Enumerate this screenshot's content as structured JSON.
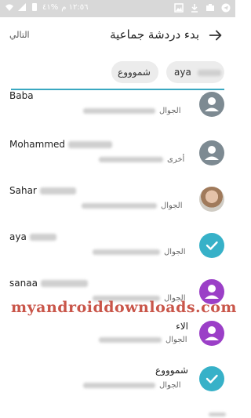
{
  "status_bar": {
    "time": "١٢:٥٦ م",
    "battery": "%٤١",
    "icons": [
      "signal-icon",
      "wifi-icon",
      "battery-icon",
      "gallery-icon",
      "download-icon",
      "app-icon",
      "telegram-icon"
    ]
  },
  "toolbar": {
    "title": "بدء دردشة جماعية",
    "next_label": "التالي",
    "back_icon": "arrow-right-icon"
  },
  "selected_chips": [
    {
      "label": "aya"
    },
    {
      "label": "شموووع"
    }
  ],
  "contacts": [
    {
      "name": "Baba",
      "phone_type": "الجوال",
      "avatar": "default",
      "selected": false
    },
    {
      "name": "Mohammed",
      "phone_type": "أخرى",
      "avatar": "default",
      "selected": false
    },
    {
      "name": "Sahar",
      "phone_type": "الجوال",
      "avatar": "photo",
      "selected": false
    },
    {
      "name": "aya",
      "phone_type": "الجوال",
      "avatar": "check",
      "selected": true
    },
    {
      "name": "sanaa",
      "phone_type": "الجوال",
      "avatar": "purple",
      "selected": false
    },
    {
      "name": "الاء",
      "phone_type": "الجوال",
      "avatar": "purple",
      "selected": false
    },
    {
      "name": "شموووع",
      "phone_type": "الجوال",
      "avatar": "check",
      "selected": true
    }
  ],
  "watermark": "myandroiddownloads.com",
  "colors": {
    "accent": "#37b1c8",
    "purple": "#9b3fc7",
    "grey_avatar": "#7d8a92",
    "watermark": "#c0392b"
  }
}
